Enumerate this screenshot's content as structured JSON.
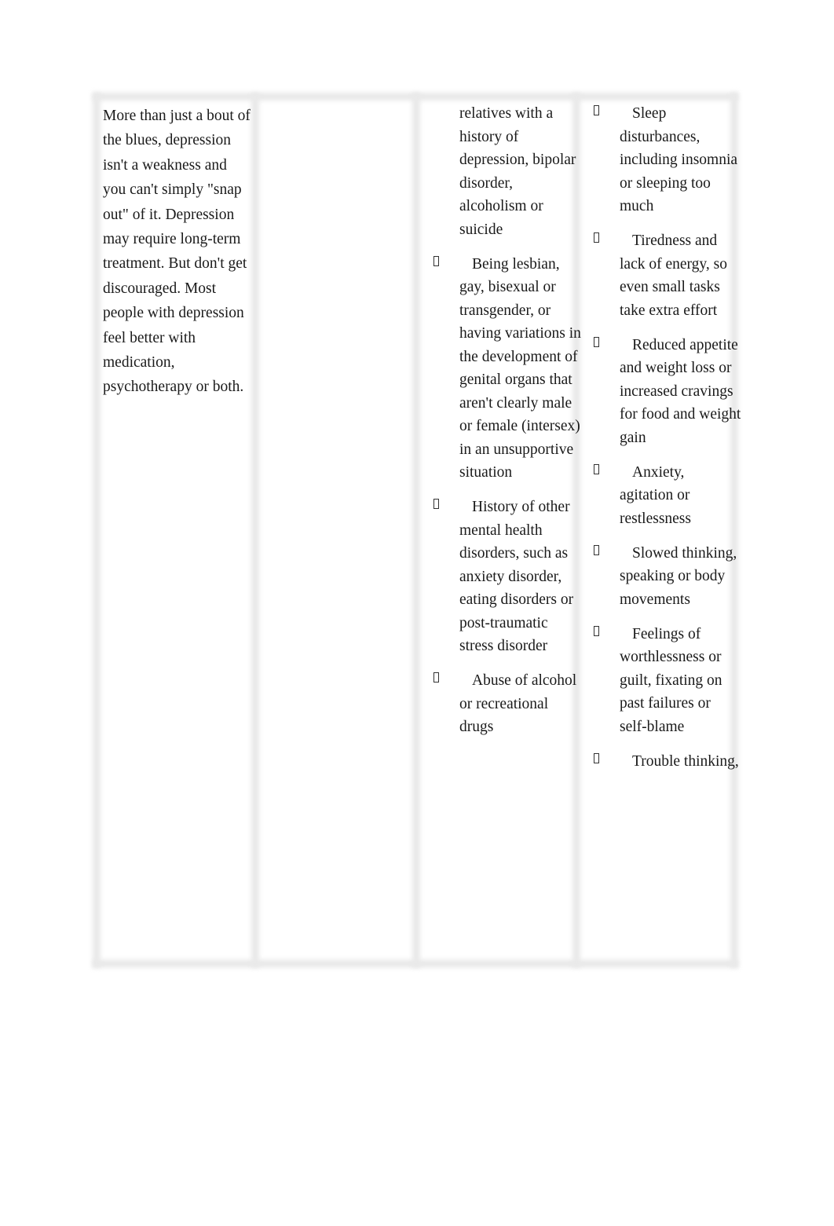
{
  "columns": {
    "intro_text": "More than just a bout of the blues, depression isn't a weakness and you can't simply \"snap out\" of it. Depression may require long-term treatment. But don't get discouraged. Most people with depression feel better with medication, psychotherapy or both.",
    "risk_factors": {
      "continued_text": "relatives with a history of depression, bipolar disorder, alcoholism or suicide",
      "items": [
        "Being lesbian, gay, bisexual or transgender, or having variations in the development of genital organs that aren't clearly male or female (intersex) in an unsupportive situation",
        "History of other mental health disorders, such as anxiety disorder, eating disorders or post-traumatic stress disorder",
        "Abuse of alcohol or recreational drugs"
      ]
    },
    "symptoms": {
      "items": [
        "Sleep disturbances, including insomnia or sleeping too much",
        "Tiredness and lack of energy, so even small tasks take extra effort",
        "Reduced appetite and weight loss or increased cravings for food and weight gain",
        "Anxiety, agitation or restlessness",
        "Slowed thinking, speaking or body movements",
        "Feelings of worthlessness or guilt, fixating on past failures or self-blame",
        "Trouble thinking,"
      ]
    }
  }
}
